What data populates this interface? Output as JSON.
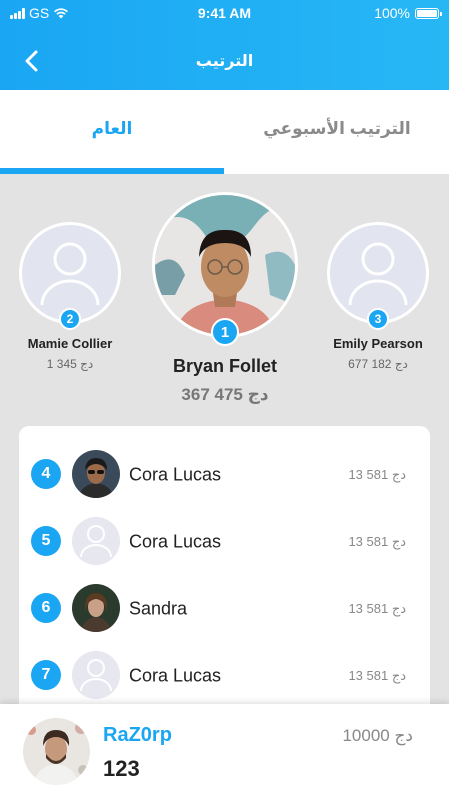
{
  "status_bar": {
    "carrier": "GS",
    "time": "9:41 AM",
    "battery": "100%"
  },
  "header": {
    "title": "الترتيب",
    "back_icon": "chevron-left-icon"
  },
  "tabs": [
    {
      "label": "العام",
      "active": true
    },
    {
      "label": "الترتيب الأسبوعي",
      "active": false
    }
  ],
  "podium": {
    "first": {
      "rank": "1",
      "name": "Bryan Follet",
      "score": "367 475 دج"
    },
    "second": {
      "rank": "2",
      "name": "Mamie Collier",
      "score": "1 345 دج"
    },
    "third": {
      "rank": "3",
      "name": "Emily Pearson",
      "score": "677 182 دج"
    }
  },
  "ranking_list": [
    {
      "rank": "4",
      "name": "Cora Lucas",
      "score": "13 581 دج",
      "avatar": "photo"
    },
    {
      "rank": "5",
      "name": "Cora Lucas",
      "score": "13 581 دج",
      "avatar": "placeholder"
    },
    {
      "rank": "6",
      "name": "Sandra",
      "score": "13 581 دج",
      "avatar": "photo"
    },
    {
      "rank": "7",
      "name": "Cora Lucas",
      "score": "13 581 دج",
      "avatar": "placeholder"
    }
  ],
  "current_user": {
    "username": "RaZ0rp",
    "points": "123",
    "balance": "10000 دج"
  },
  "colors": {
    "accent": "#1aa6f3",
    "background": "#e3e3e3"
  }
}
